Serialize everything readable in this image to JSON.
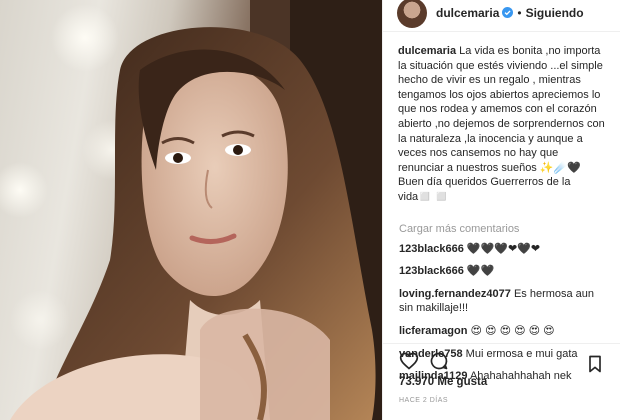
{
  "post": {
    "header": {
      "username": "dulcemaria",
      "separator": "•",
      "follow_label": "Siguiendo"
    },
    "caption": {
      "username": "dulcemaria",
      "text": "La vida es bonita ,no importa la situación que estés viviendo ...el simple hecho de vivir es un regalo , mientras tengamos los ojos abiertos apreciemos lo que nos rodea y amemos con el corazón abierto ,no dejemos de sorprendernos con la naturaleza ,la inocencia y aunque a veces nos cansemos no hay que renunciar a nuestros sueños ✨☄️🖤 Buen día queridos Guerrerros de la vida◻️ ◻️"
    },
    "load_more_label": "Cargar más comentarios",
    "comments": [
      {
        "username": "123black666",
        "text": "🖤🖤🖤❤🖤❤"
      },
      {
        "username": "123black666",
        "text": "🖤🖤"
      },
      {
        "username": "loving.fernandez4077",
        "text": "Es hermosa aun sin makillaje!!!"
      },
      {
        "username": "licferamagon",
        "text": "😍 😍 😍 😍 😍 😍"
      },
      {
        "username": "vanderle758",
        "text": "Mui ermosa e mui gata"
      },
      {
        "username": "majlinda1129",
        "text": "Ahahahahhahah nek"
      }
    ],
    "likes_text": "73.970 Me gusta",
    "timestamp": "HACE 2 DÍAS",
    "icons": [
      "heart-icon",
      "comment-icon",
      "bookmark-icon",
      "verified-icon"
    ]
  }
}
